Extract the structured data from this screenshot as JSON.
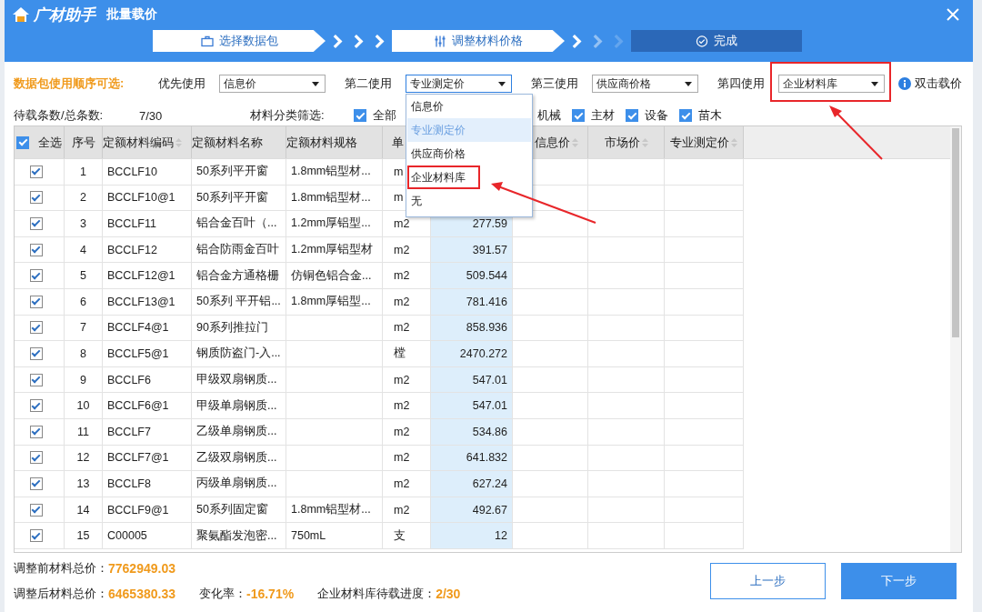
{
  "window": {
    "logo": "广材助手",
    "title": "批量载价"
  },
  "steps": [
    {
      "label": "选择数据包",
      "reached": true
    },
    {
      "label": "调整材料价格",
      "reached": true
    },
    {
      "label": "完成",
      "reached": false
    }
  ],
  "order": {
    "label": "数据包使用顺序可选:",
    "hint": "双击载价",
    "slots": [
      {
        "label": "优先使用",
        "value": "信息价",
        "open": false
      },
      {
        "label": "第二使用",
        "value": "专业测定价",
        "open": true
      },
      {
        "label": "第三使用",
        "value": "供应商价格",
        "open": false
      },
      {
        "label": "第四使用",
        "value": "企业材料库",
        "highlighted": true,
        "open": false
      }
    ]
  },
  "menu": {
    "items": [
      {
        "label": "信息价",
        "selected": false,
        "highlighted": false
      },
      {
        "label": "专业测定价",
        "selected": true,
        "highlighted": false
      },
      {
        "label": "供应商价格",
        "selected": false,
        "highlighted": false
      },
      {
        "label": "企业材料库",
        "selected": false,
        "highlighted": true
      },
      {
        "label": "无",
        "selected": false,
        "highlighted": false
      }
    ]
  },
  "counts": {
    "label": "待载条数/总条数:",
    "value": "7/30"
  },
  "filters": {
    "label": "材料分类筛选:",
    "items": [
      {
        "label": "全部",
        "checked": true
      },
      {
        "label": "机械"
      },
      {
        "label": "主材",
        "checked": true
      },
      {
        "label": "设备",
        "checked": true
      },
      {
        "label": "苗木",
        "checked": true
      }
    ]
  },
  "table": {
    "select_all": {
      "label": "全选",
      "checked": true
    },
    "columns": [
      {
        "label": "序号",
        "sortable": false
      },
      {
        "label": "定额材料编码",
        "sortable": true
      },
      {
        "label": "定额材料名称",
        "sortable": false
      },
      {
        "label": "定额材料规格",
        "sortable": false
      },
      {
        "label": "单",
        "sortable": false
      },
      {
        "kind": "loaded"
      },
      {
        "label": "信息价",
        "sortable": true
      },
      {
        "label": "市场价",
        "sortable": true
      },
      {
        "label": "专业测定价",
        "sortable": true
      }
    ],
    "rows": [
      {
        "checked": true,
        "no": "1",
        "code": "BCCLF10",
        "name": "50系列平开窗",
        "spec": "1.8mm铝型材...",
        "unit": "m"
      },
      {
        "checked": true,
        "no": "2",
        "code": "BCCLF10@1",
        "name": "50系列平开窗",
        "spec": "1.8mm铝型材...",
        "unit": "m"
      },
      {
        "checked": true,
        "no": "3",
        "code": "BCCLF11",
        "name": "铝合金百叶（...",
        "spec": "1.2mm厚铝型...",
        "unit": "m2",
        "price": "277.59"
      },
      {
        "checked": true,
        "no": "4",
        "code": "BCCLF12",
        "name": "铝合防雨金百叶",
        "spec": "1.2mm厚铝型材",
        "unit": "m2",
        "price": "391.57"
      },
      {
        "checked": true,
        "no": "5",
        "code": "BCCLF12@1",
        "name": "铝合金方通格栅",
        "spec": "仿铜色铝合金...",
        "unit": "m2",
        "price": "509.544"
      },
      {
        "checked": true,
        "no": "6",
        "code": "BCCLF13@1",
        "name": "50系列 平开铝...",
        "spec": "1.8mm厚铝型...",
        "unit": "m2",
        "price": "781.416"
      },
      {
        "checked": true,
        "no": "7",
        "code": "BCCLF4@1",
        "name": "90系列推拉门",
        "unit": "m2",
        "price": "858.936"
      },
      {
        "checked": true,
        "no": "8",
        "code": "BCCLF5@1",
        "name": "钢质防盗门-入...",
        "unit": "樘",
        "price": "2470.272"
      },
      {
        "checked": true,
        "no": "9",
        "code": "BCCLF6",
        "name": "甲级双扇钢质...",
        "unit": "m2",
        "price": "547.01"
      },
      {
        "checked": true,
        "no": "10",
        "code": "BCCLF6@1",
        "name": "甲级单扇钢质...",
        "unit": "m2",
        "price": "547.01"
      },
      {
        "checked": true,
        "no": "11",
        "code": "BCCLF7",
        "name": "乙级单扇钢质...",
        "unit": "m2",
        "price": "534.86"
      },
      {
        "checked": true,
        "no": "12",
        "code": "BCCLF7@1",
        "name": "乙级双扇钢质...",
        "unit": "m2",
        "price": "641.832"
      },
      {
        "checked": true,
        "no": "13",
        "code": "BCCLF8",
        "name": "丙级单扇钢质...",
        "unit": "m2",
        "price": "627.24"
      },
      {
        "checked": true,
        "no": "14",
        "code": "BCCLF9@1",
        "name": "50系列固定窗",
        "spec": "1.8mm铝型材...",
        "unit": "m2",
        "price": "492.67"
      },
      {
        "checked": true,
        "no": "15",
        "code": "C00005",
        "name": "聚氨酯发泡密...",
        "spec": "750mL",
        "unit": "支",
        "price": "12"
      }
    ]
  },
  "footer": {
    "before": {
      "label": "调整前材料总价：",
      "value": "7762949.03"
    },
    "after": {
      "label": "调整后材料总价：",
      "value": "6465380.33"
    },
    "change": {
      "label": "变化率：",
      "value": "-16.71%"
    },
    "progress": {
      "label": "企业材料库待载进度：",
      "value": "2/30"
    }
  },
  "buttons": [
    {
      "label": "上一步",
      "kind": "secondary"
    },
    {
      "label": "下一步",
      "kind": "primary"
    }
  ]
}
